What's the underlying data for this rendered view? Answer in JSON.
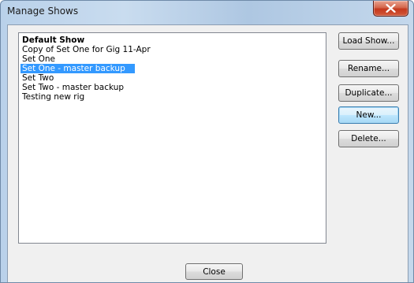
{
  "window": {
    "title": "Manage Shows"
  },
  "shows": [
    {
      "label": "Default Show",
      "bold": true,
      "selected": false
    },
    {
      "label": "Copy of Set One for Gig 11-Apr",
      "bold": false,
      "selected": false
    },
    {
      "label": "Set One",
      "bold": false,
      "selected": false
    },
    {
      "label": "Set One - master backup",
      "bold": false,
      "selected": true
    },
    {
      "label": "Set Two",
      "bold": false,
      "selected": false
    },
    {
      "label": "Set Two - master backup",
      "bold": false,
      "selected": false
    },
    {
      "label": "Testing new rig",
      "bold": false,
      "selected": false
    }
  ],
  "buttons": {
    "load_show": "Load Show...",
    "rename": "Rename...",
    "duplicate": "Duplicate...",
    "new": "New...",
    "delete": "Delete...",
    "close": "Close"
  },
  "colors": {
    "selection": "#3399ff",
    "close_button": "#c4391d"
  },
  "icons": {
    "window_close": "close-icon"
  }
}
